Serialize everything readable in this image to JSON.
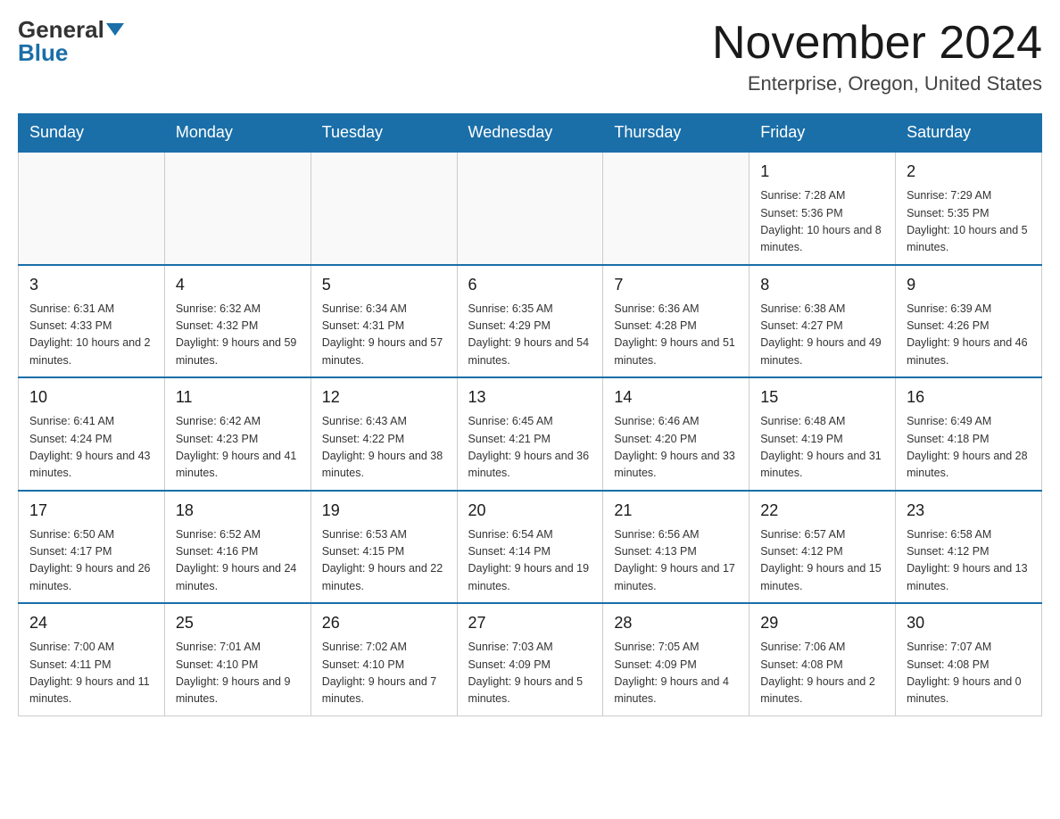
{
  "logo": {
    "general": "General",
    "blue": "Blue"
  },
  "title": "November 2024",
  "subtitle": "Enterprise, Oregon, United States",
  "days_of_week": [
    "Sunday",
    "Monday",
    "Tuesday",
    "Wednesday",
    "Thursday",
    "Friday",
    "Saturday"
  ],
  "weeks": [
    [
      {
        "day": "",
        "info": ""
      },
      {
        "day": "",
        "info": ""
      },
      {
        "day": "",
        "info": ""
      },
      {
        "day": "",
        "info": ""
      },
      {
        "day": "",
        "info": ""
      },
      {
        "day": "1",
        "info": "Sunrise: 7:28 AM\nSunset: 5:36 PM\nDaylight: 10 hours and 8 minutes."
      },
      {
        "day": "2",
        "info": "Sunrise: 7:29 AM\nSunset: 5:35 PM\nDaylight: 10 hours and 5 minutes."
      }
    ],
    [
      {
        "day": "3",
        "info": "Sunrise: 6:31 AM\nSunset: 4:33 PM\nDaylight: 10 hours and 2 minutes."
      },
      {
        "day": "4",
        "info": "Sunrise: 6:32 AM\nSunset: 4:32 PM\nDaylight: 9 hours and 59 minutes."
      },
      {
        "day": "5",
        "info": "Sunrise: 6:34 AM\nSunset: 4:31 PM\nDaylight: 9 hours and 57 minutes."
      },
      {
        "day": "6",
        "info": "Sunrise: 6:35 AM\nSunset: 4:29 PM\nDaylight: 9 hours and 54 minutes."
      },
      {
        "day": "7",
        "info": "Sunrise: 6:36 AM\nSunset: 4:28 PM\nDaylight: 9 hours and 51 minutes."
      },
      {
        "day": "8",
        "info": "Sunrise: 6:38 AM\nSunset: 4:27 PM\nDaylight: 9 hours and 49 minutes."
      },
      {
        "day": "9",
        "info": "Sunrise: 6:39 AM\nSunset: 4:26 PM\nDaylight: 9 hours and 46 minutes."
      }
    ],
    [
      {
        "day": "10",
        "info": "Sunrise: 6:41 AM\nSunset: 4:24 PM\nDaylight: 9 hours and 43 minutes."
      },
      {
        "day": "11",
        "info": "Sunrise: 6:42 AM\nSunset: 4:23 PM\nDaylight: 9 hours and 41 minutes."
      },
      {
        "day": "12",
        "info": "Sunrise: 6:43 AM\nSunset: 4:22 PM\nDaylight: 9 hours and 38 minutes."
      },
      {
        "day": "13",
        "info": "Sunrise: 6:45 AM\nSunset: 4:21 PM\nDaylight: 9 hours and 36 minutes."
      },
      {
        "day": "14",
        "info": "Sunrise: 6:46 AM\nSunset: 4:20 PM\nDaylight: 9 hours and 33 minutes."
      },
      {
        "day": "15",
        "info": "Sunrise: 6:48 AM\nSunset: 4:19 PM\nDaylight: 9 hours and 31 minutes."
      },
      {
        "day": "16",
        "info": "Sunrise: 6:49 AM\nSunset: 4:18 PM\nDaylight: 9 hours and 28 minutes."
      }
    ],
    [
      {
        "day": "17",
        "info": "Sunrise: 6:50 AM\nSunset: 4:17 PM\nDaylight: 9 hours and 26 minutes."
      },
      {
        "day": "18",
        "info": "Sunrise: 6:52 AM\nSunset: 4:16 PM\nDaylight: 9 hours and 24 minutes."
      },
      {
        "day": "19",
        "info": "Sunrise: 6:53 AM\nSunset: 4:15 PM\nDaylight: 9 hours and 22 minutes."
      },
      {
        "day": "20",
        "info": "Sunrise: 6:54 AM\nSunset: 4:14 PM\nDaylight: 9 hours and 19 minutes."
      },
      {
        "day": "21",
        "info": "Sunrise: 6:56 AM\nSunset: 4:13 PM\nDaylight: 9 hours and 17 minutes."
      },
      {
        "day": "22",
        "info": "Sunrise: 6:57 AM\nSunset: 4:12 PM\nDaylight: 9 hours and 15 minutes."
      },
      {
        "day": "23",
        "info": "Sunrise: 6:58 AM\nSunset: 4:12 PM\nDaylight: 9 hours and 13 minutes."
      }
    ],
    [
      {
        "day": "24",
        "info": "Sunrise: 7:00 AM\nSunset: 4:11 PM\nDaylight: 9 hours and 11 minutes."
      },
      {
        "day": "25",
        "info": "Sunrise: 7:01 AM\nSunset: 4:10 PM\nDaylight: 9 hours and 9 minutes."
      },
      {
        "day": "26",
        "info": "Sunrise: 7:02 AM\nSunset: 4:10 PM\nDaylight: 9 hours and 7 minutes."
      },
      {
        "day": "27",
        "info": "Sunrise: 7:03 AM\nSunset: 4:09 PM\nDaylight: 9 hours and 5 minutes."
      },
      {
        "day": "28",
        "info": "Sunrise: 7:05 AM\nSunset: 4:09 PM\nDaylight: 9 hours and 4 minutes."
      },
      {
        "day": "29",
        "info": "Sunrise: 7:06 AM\nSunset: 4:08 PM\nDaylight: 9 hours and 2 minutes."
      },
      {
        "day": "30",
        "info": "Sunrise: 7:07 AM\nSunset: 4:08 PM\nDaylight: 9 hours and 0 minutes."
      }
    ]
  ]
}
